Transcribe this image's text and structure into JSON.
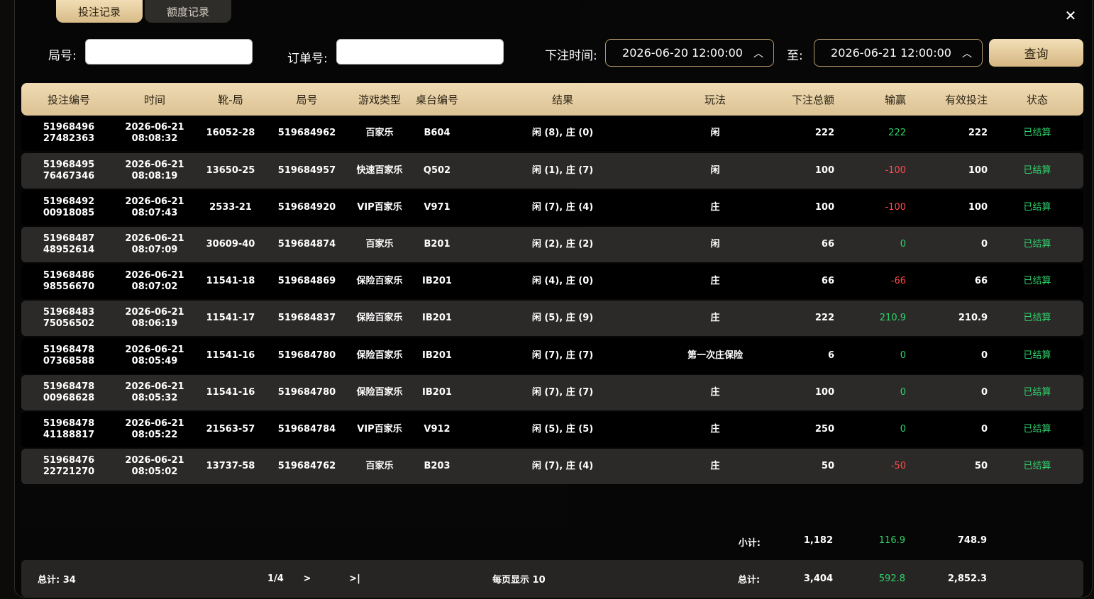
{
  "tabs": [
    {
      "label": "投注记录",
      "active": true
    },
    {
      "label": "额度记录",
      "active": false
    }
  ],
  "close_icon": "close-icon",
  "filters": {
    "round_label": "局号:",
    "round_value": "",
    "order_label": "订单号:",
    "order_value": "",
    "time_label": "下注时间:",
    "start_time": "2026-06-20 12:00:00",
    "to_label": "至:",
    "end_time": "2026-06-21 12:00:00",
    "query_label": "查询"
  },
  "columns": [
    "投注编号",
    "时间",
    "靴-局",
    "局号",
    "游戏类型",
    "桌台编号",
    "结果",
    "玩法",
    "下注总额",
    "输赢",
    "有效投注",
    "状态"
  ],
  "rows": [
    {
      "id1": "51968496",
      "id2": "27482363",
      "date": "2026-06-21",
      "time": "08:08:32",
      "shoe": "16052-28",
      "round": "519684962",
      "game": "百家乐",
      "table": "B604",
      "result": "闲 (8), 庄 (0)",
      "play": "闲",
      "amount": "222",
      "winloss": "222",
      "wl_sign": "pos",
      "valid": "222",
      "status": "已结算"
    },
    {
      "id1": "51968495",
      "id2": "76467346",
      "date": "2026-06-21",
      "time": "08:08:19",
      "shoe": "13650-25",
      "round": "519684957",
      "game": "快速百家乐",
      "table": "Q502",
      "result": "闲 (1), 庄 (7)",
      "play": "闲",
      "amount": "100",
      "winloss": "-100",
      "wl_sign": "neg",
      "valid": "100",
      "status": "已结算"
    },
    {
      "id1": "51968492",
      "id2": "00918085",
      "date": "2026-06-21",
      "time": "08:07:43",
      "shoe": "2533-21",
      "round": "519684920",
      "game": "VIP百家乐",
      "table": "V971",
      "result": "闲 (7), 庄 (4)",
      "play": "庄",
      "amount": "100",
      "winloss": "-100",
      "wl_sign": "neg",
      "valid": "100",
      "status": "已结算"
    },
    {
      "id1": "51968487",
      "id2": "48952614",
      "date": "2026-06-21",
      "time": "08:07:09",
      "shoe": "30609-40",
      "round": "519684874",
      "game": "百家乐",
      "table": "B201",
      "result": "闲 (2), 庄 (2)",
      "play": "闲",
      "amount": "66",
      "winloss": "0",
      "wl_sign": "pos",
      "valid": "0",
      "status": "已结算"
    },
    {
      "id1": "51968486",
      "id2": "98556670",
      "date": "2026-06-21",
      "time": "08:07:02",
      "shoe": "11541-18",
      "round": "519684869",
      "game": "保险百家乐",
      "table": "IB201",
      "result": "闲 (4), 庄 (0)",
      "play": "庄",
      "amount": "66",
      "winloss": "-66",
      "wl_sign": "neg",
      "valid": "66",
      "status": "已结算"
    },
    {
      "id1": "51968483",
      "id2": "75056502",
      "date": "2026-06-21",
      "time": "08:06:19",
      "shoe": "11541-17",
      "round": "519684837",
      "game": "保险百家乐",
      "table": "IB201",
      "result": "闲 (5), 庄 (9)",
      "play": "庄",
      "amount": "222",
      "winloss": "210.9",
      "wl_sign": "pos",
      "valid": "210.9",
      "status": "已结算"
    },
    {
      "id1": "51968478",
      "id2": "07368588",
      "date": "2026-06-21",
      "time": "08:05:49",
      "shoe": "11541-16",
      "round": "519684780",
      "game": "保险百家乐",
      "table": "IB201",
      "result": "闲 (7), 庄 (7)",
      "play": "第一次庄保险",
      "amount": "6",
      "winloss": "0",
      "wl_sign": "pos",
      "valid": "0",
      "status": "已结算"
    },
    {
      "id1": "51968478",
      "id2": "00968628",
      "date": "2026-06-21",
      "time": "08:05:32",
      "shoe": "11541-16",
      "round": "519684780",
      "game": "保险百家乐",
      "table": "IB201",
      "result": "闲 (7), 庄 (7)",
      "play": "庄",
      "amount": "100",
      "winloss": "0",
      "wl_sign": "pos",
      "valid": "0",
      "status": "已结算"
    },
    {
      "id1": "51968478",
      "id2": "41188817",
      "date": "2026-06-21",
      "time": "08:05:22",
      "shoe": "21563-57",
      "round": "519684784",
      "game": "VIP百家乐",
      "table": "V912",
      "result": "闲 (5), 庄 (5)",
      "play": "庄",
      "amount": "250",
      "winloss": "0",
      "wl_sign": "pos",
      "valid": "0",
      "status": "已结算"
    },
    {
      "id1": "51968476",
      "id2": "22721270",
      "date": "2026-06-21",
      "time": "08:05:02",
      "shoe": "13737-58",
      "round": "519684762",
      "game": "百家乐",
      "table": "B203",
      "result": "闲 (7), 庄 (4)",
      "play": "庄",
      "amount": "50",
      "winloss": "-50",
      "wl_sign": "neg",
      "valid": "50",
      "status": "已结算"
    }
  ],
  "subtotal": {
    "label": "小计:",
    "amount": "1,182",
    "winloss": "116.9",
    "valid": "748.9"
  },
  "footer": {
    "total_count_label": "总计: 34",
    "page": "1/4",
    "next": ">",
    "last": ">|",
    "per_page": "每页显示 10",
    "total_label": "总计:",
    "total_amount": "3,404",
    "total_winloss": "592.8",
    "total_valid": "2,852.3"
  },
  "colors": {
    "gold": "#e3c998",
    "win": "#2fd36b",
    "loss": "#ff4a4a"
  }
}
